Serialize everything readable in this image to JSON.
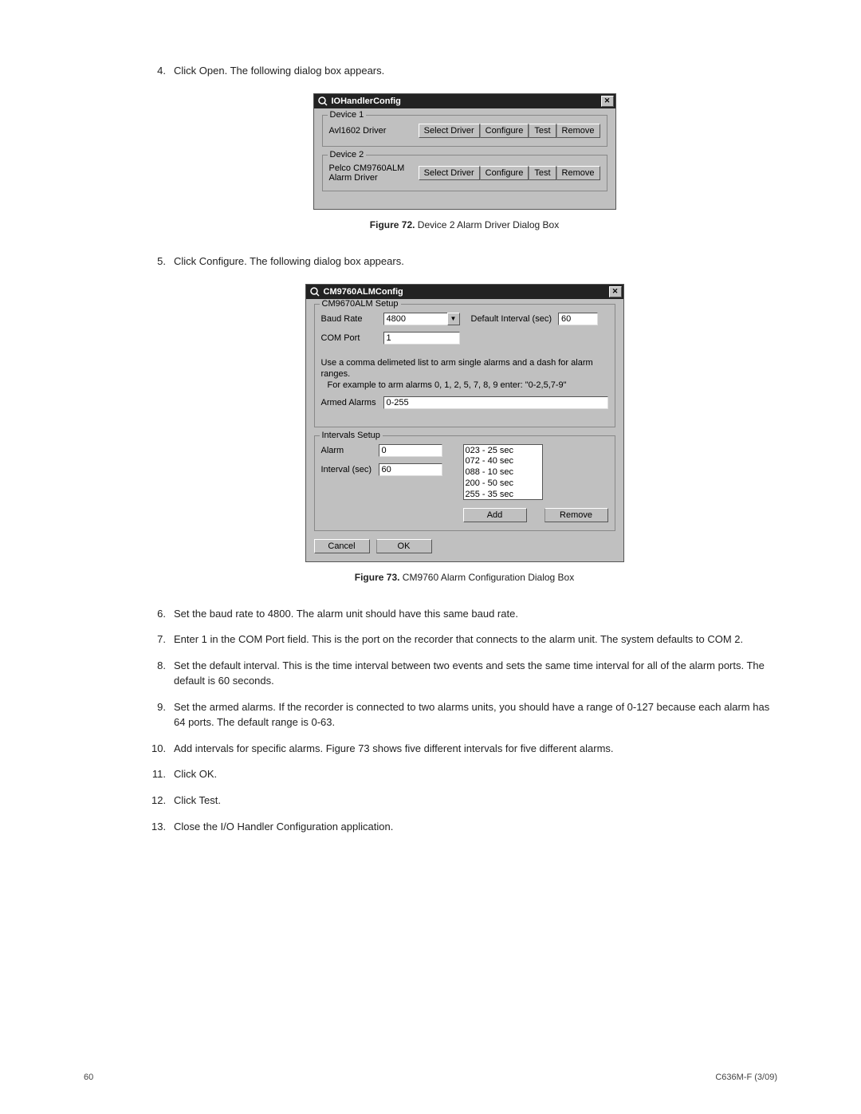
{
  "steps_a": {
    "4": {
      "num": "4.",
      "text": "Click Open. The following dialog box appears."
    }
  },
  "dlg1": {
    "title": "IOHandlerConfig",
    "close_label": "✕",
    "dev1": {
      "legend": "Device 1",
      "name": "Avl1602 Driver",
      "select": "Select Driver",
      "configure": "Configure",
      "test": "Test",
      "remove": "Remove"
    },
    "dev2": {
      "legend": "Device 2",
      "name": "Pelco CM9760ALM Alarm Driver",
      "select": "Select Driver",
      "configure": "Configure",
      "test": "Test",
      "remove": "Remove"
    }
  },
  "fig72": {
    "label": "Figure 72.",
    "text": "  Device 2 Alarm Driver Dialog Box"
  },
  "steps_b": {
    "5": {
      "num": "5.",
      "text": "Click Configure. The following dialog box appears."
    }
  },
  "dlg2": {
    "title": "CM9760ALMConfig",
    "close_label": "✕",
    "setup_legend": "CM9670ALM Setup",
    "baud_label": "Baud Rate",
    "baud_value": "4800",
    "interval_label": "Default Interval (sec)",
    "interval_value": "60",
    "com_label": "COM Port",
    "com_value": "1",
    "help_l1": "Use a comma delimeted list to arm single alarms and a dash for alarm ranges.",
    "help_l2": "For example to arm alarms 0, 1, 2, 5, 7, 8, 9  enter: \"0-2,5,7-9\"",
    "armed_label": "Armed Alarms",
    "armed_value": "0-255",
    "intervals_legend": "Intervals Setup",
    "alarm_label": "Alarm",
    "alarm_value": "0",
    "intsec_label": "Interval (sec)",
    "intsec_value": "60",
    "list": {
      "i0": "023 - 25 sec",
      "i1": "072 - 40 sec",
      "i2": "088 - 10 sec",
      "i3": "200 - 50 sec",
      "i4": "255 - 35 sec"
    },
    "add": "Add",
    "remove": "Remove",
    "cancel": "Cancel",
    "ok": "OK"
  },
  "fig73": {
    "label": "Figure 73.",
    "text": "  CM9760 Alarm Configuration Dialog Box"
  },
  "steps_c": {
    "6": {
      "num": "6.",
      "text": "Set the baud rate to 4800. The alarm unit should have this same baud rate."
    },
    "7": {
      "num": "7.",
      "text": "Enter 1 in the COM Port field. This is the port on the recorder that connects to the alarm unit. The system defaults to COM 2."
    },
    "8": {
      "num": "8.",
      "text": "Set the default interval. This is the time interval between two events and sets the same time interval for all of the alarm ports. The default is 60 seconds."
    },
    "9": {
      "num": "9.",
      "text": "Set the armed alarms. If the recorder is connected to two alarms units, you should have a range of 0-127 because each alarm has 64 ports. The default range is 0-63."
    },
    "10": {
      "num": "10.",
      "text": "Add intervals for specific alarms. Figure 73 shows five different intervals for five different alarms."
    },
    "11": {
      "num": "11.",
      "text": "Click OK."
    },
    "12": {
      "num": "12.",
      "text": "Click Test."
    },
    "13": {
      "num": "13.",
      "text": "Close the I/O Handler Configuration application."
    }
  },
  "footer": {
    "page": "60",
    "doc": "C636M-F (3/09)"
  }
}
